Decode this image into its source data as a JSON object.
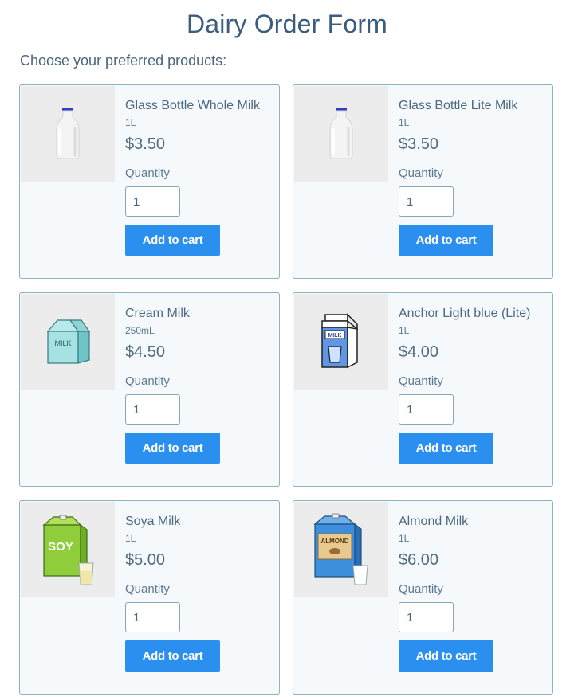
{
  "page": {
    "title": "Dairy Order Form",
    "subtitle": "Choose your preferred products:"
  },
  "products": [
    {
      "name": "Glass Bottle Whole Milk",
      "volume": "1L",
      "price": "$3.50",
      "quantity_label": "Quantity",
      "quantity": "1",
      "button": "Add to cart",
      "icon": "milk-bottle-icon"
    },
    {
      "name": "Glass Bottle Lite Milk",
      "volume": "1L",
      "price": "$3.50",
      "quantity_label": "Quantity",
      "quantity": "1",
      "button": "Add to cart",
      "icon": "milk-bottle-icon"
    },
    {
      "name": "Cream Milk",
      "volume": "250mL",
      "price": "$4.50",
      "quantity_label": "Quantity",
      "quantity": "1",
      "button": "Add to cart",
      "icon": "milk-carton-icon",
      "icon_text": "MILK"
    },
    {
      "name": "Anchor Light blue (Lite)",
      "volume": "1L",
      "price": "$4.00",
      "quantity_label": "Quantity",
      "quantity": "1",
      "button": "Add to cart",
      "icon": "milk-carton-glass-icon",
      "icon_text": "MILK"
    },
    {
      "name": "Soya Milk",
      "volume": "1L",
      "price": "$5.00",
      "quantity_label": "Quantity",
      "quantity": "1",
      "button": "Add to cart",
      "icon": "soy-carton-icon",
      "icon_text": "SOY"
    },
    {
      "name": "Almond Milk",
      "volume": "1L",
      "price": "$6.00",
      "quantity_label": "Quantity",
      "quantity": "1",
      "button": "Add to cart",
      "icon": "almond-carton-icon",
      "icon_text": "ALMOND"
    }
  ],
  "colors": {
    "button": "#2b8ff0",
    "card_border": "#8fb2c2",
    "card_background": "#f5f9fc",
    "title": "#3c5c7e"
  }
}
